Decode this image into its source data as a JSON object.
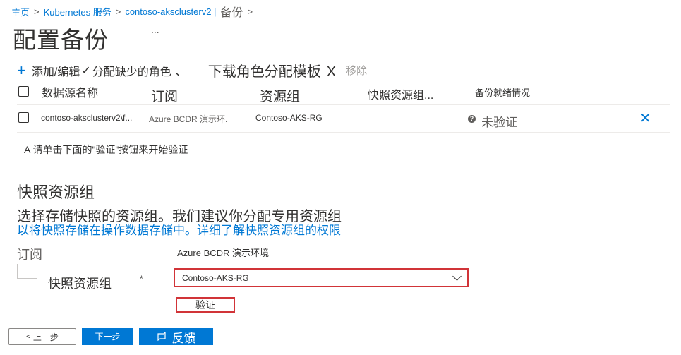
{
  "breadcrumb": {
    "home": "主页",
    "service": "Kubernetes 服务",
    "cluster": "contoso-aksclusterv2 |",
    "current": "备份"
  },
  "page": {
    "title": "配置备份",
    "more": "..."
  },
  "toolbar": {
    "add_label": "添加/编辑",
    "assign_label": "分配缺少的角色",
    "download_label": "下载角色分配模板",
    "download_x": "X",
    "remove_label": "移除"
  },
  "table": {
    "headers": {
      "name": "数据源名称",
      "subscription": "订阅",
      "rg": "资源组",
      "snapshot_rg": "快照资源组...",
      "readiness": "备份就绪情况"
    },
    "rows": [
      {
        "name": "contoso-aksclusterv2\\f...",
        "subscription": "Azure BCDR 演示环.",
        "rg": "Contoso-AKS-RG",
        "status": "未验证"
      }
    ]
  },
  "hint": "A 请单击下面的\"验证\"按钮来开始验证",
  "section": {
    "heading": "快照资源组",
    "desc": "选择存储快照的资源组。我们建议你分配专用资源组",
    "link": "以将快照存储在操作数据存储中。详细了解快照资源组的权限"
  },
  "form": {
    "subscription_label": "订阅",
    "subscription_value": "Azure BCDR 演示环境",
    "snapshot_rg_label": "快照资源组",
    "required": "*",
    "snapshot_rg_value": "Contoso-AKS-RG",
    "validate_button": "验证"
  },
  "footer": {
    "prev": "上一步",
    "next": "下一步",
    "feedback": "反馈"
  },
  "colors": {
    "accent": "#0078d4",
    "highlight": "#d13438"
  }
}
